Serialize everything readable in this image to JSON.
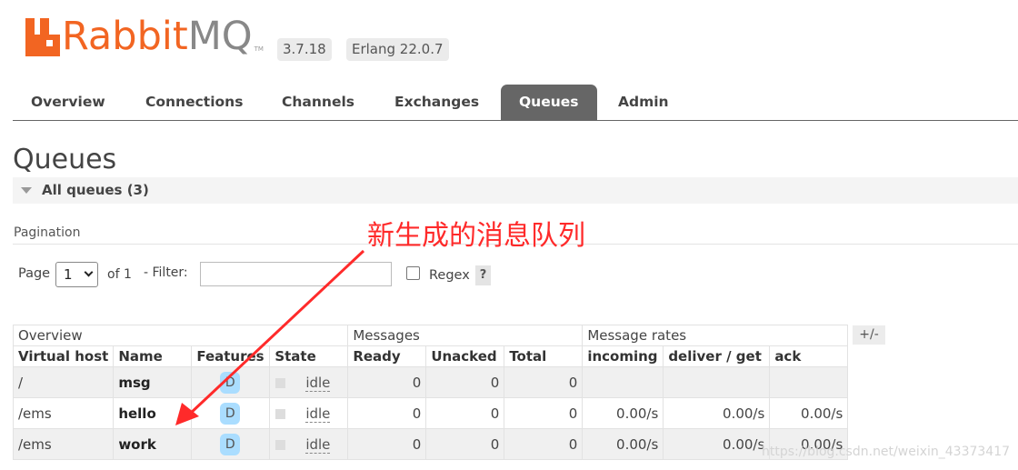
{
  "header": {
    "logo_text": "Rabbit",
    "logo_text_mq": "MQ",
    "logo_tm": "TM",
    "version": "3.7.18",
    "erlang": "Erlang 22.0.7"
  },
  "tabs": [
    {
      "label": "Overview",
      "active": false
    },
    {
      "label": "Connections",
      "active": false
    },
    {
      "label": "Channels",
      "active": false
    },
    {
      "label": "Exchanges",
      "active": false
    },
    {
      "label": "Queues",
      "active": true
    },
    {
      "label": "Admin",
      "active": false
    }
  ],
  "page_title": "Queues",
  "section": {
    "label": "All queues (3)"
  },
  "pagination": {
    "label": "Pagination",
    "page_label": "Page",
    "page_value": "1",
    "of_text": "of 1",
    "filter_label": "- Filter:",
    "filter_value": "",
    "regex_label": "Regex",
    "regex_checked": false,
    "help_label": "?"
  },
  "table": {
    "groups": [
      "Overview",
      "Messages",
      "Message rates"
    ],
    "columns": [
      "Virtual host",
      "Name",
      "Features",
      "State",
      "Ready",
      "Unacked",
      "Total",
      "incoming",
      "deliver / get",
      "ack"
    ],
    "toggle_label": "+/-",
    "rows": [
      {
        "vhost": "/",
        "name": "msg",
        "feature": "D",
        "state": "idle",
        "ready": "0",
        "unacked": "0",
        "total": "0",
        "incoming": "",
        "deliver_get": "",
        "ack": ""
      },
      {
        "vhost": "/ems",
        "name": "hello",
        "feature": "D",
        "state": "idle",
        "ready": "0",
        "unacked": "0",
        "total": "0",
        "incoming": "0.00/s",
        "deliver_get": "0.00/s",
        "ack": "0.00/s"
      },
      {
        "vhost": "/ems",
        "name": "work",
        "feature": "D",
        "state": "idle",
        "ready": "0",
        "unacked": "0",
        "total": "0",
        "incoming": "0.00/s",
        "deliver_get": "0.00/s",
        "ack": "0.00/s"
      }
    ]
  },
  "annotation": {
    "text": "新生成的消息队列",
    "color": "#ff2a2a"
  },
  "watermark": "https://blog.csdn.net/weixin_43373417",
  "colors": {
    "brand": "#f26522",
    "tab_active": "#666666",
    "badge": "#aaddff"
  }
}
